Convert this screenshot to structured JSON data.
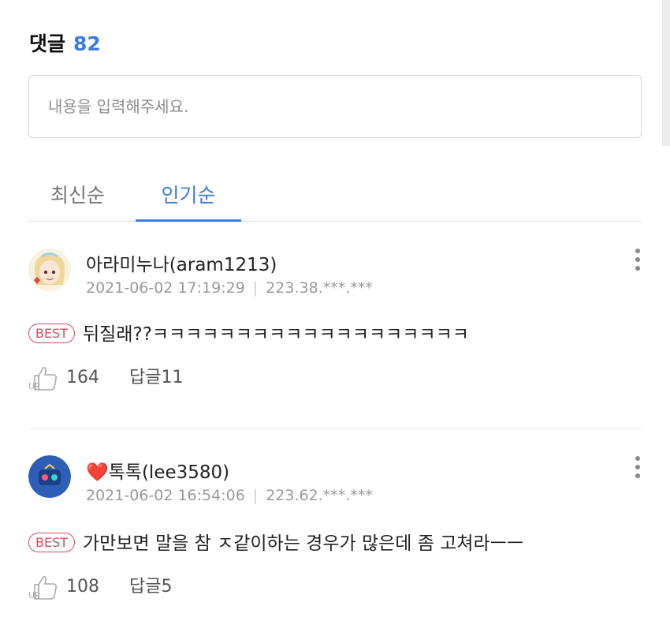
{
  "header": {
    "title": "댓글",
    "count": "82"
  },
  "comment_input": {
    "placeholder": "내용을 입력해주세요."
  },
  "tabs": [
    {
      "label": "최신순",
      "active": false
    },
    {
      "label": "인기순",
      "active": true
    }
  ],
  "comments": [
    {
      "nickname": "아라미누나(aram1213)",
      "datetime": "2021-06-02 17:19:29",
      "ip": "223.38.***.***",
      "badge": "BEST",
      "text": "뒤질래??ㅋㅋㅋㅋㅋㅋㅋㅋㅋㅋㅋㅋㅋㅋㅋㅋㅋㅋㅋ",
      "likes": "164",
      "reply_label": "답글11"
    },
    {
      "nickname": "❤️톡톡(lee3580)",
      "datetime": "2021-06-02 16:54:06",
      "ip": "223.62.***.***",
      "badge": "BEST",
      "text": "가만보면 말을 참 ㅈ같이하는 경우가 많은데 좀 고쳐라ㅡㅡ",
      "likes": "108",
      "reply_label": "답글5"
    }
  ],
  "icons": {
    "like": "thumbs-up-icon",
    "more": "more-vertical-icon"
  },
  "colors": {
    "accent": "#3d7be0",
    "best": "#d94a5a"
  }
}
